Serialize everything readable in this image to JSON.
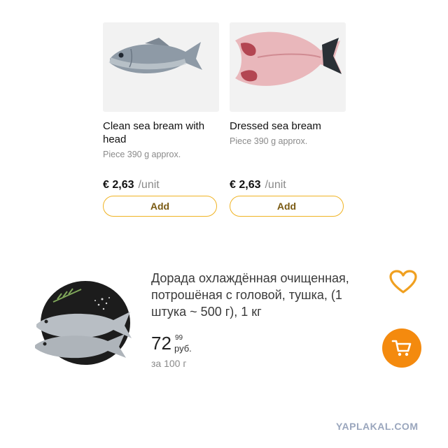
{
  "products": [
    {
      "title": "Clean sea bream with head",
      "subtitle": "Piece 390 g approx.",
      "price": "€ 2,63",
      "unit": "/unit",
      "add_label": "Add",
      "image": "whole-sea-bream-icon"
    },
    {
      "title": "Dressed sea bream",
      "subtitle": "Piece 390 g approx.",
      "price": "€ 2,63",
      "unit": "/unit",
      "add_label": "Add",
      "image": "butterflied-sea-bream-icon"
    }
  ],
  "ru_product": {
    "title": "Дорада охлаждённая очищенная, потрошёная с головой, тушка, (1 штука ~ 500 г), 1 кг",
    "price_rub": "72",
    "price_kop": "99",
    "currency": "руб.",
    "per": "за 100 г",
    "image": "two-dorado-on-plate-icon"
  },
  "watermark": "YAPLAKAL.COM",
  "colors": {
    "add_border": "#f0b323",
    "heart": "#f0a020",
    "cart_button": "#f48a0e"
  }
}
